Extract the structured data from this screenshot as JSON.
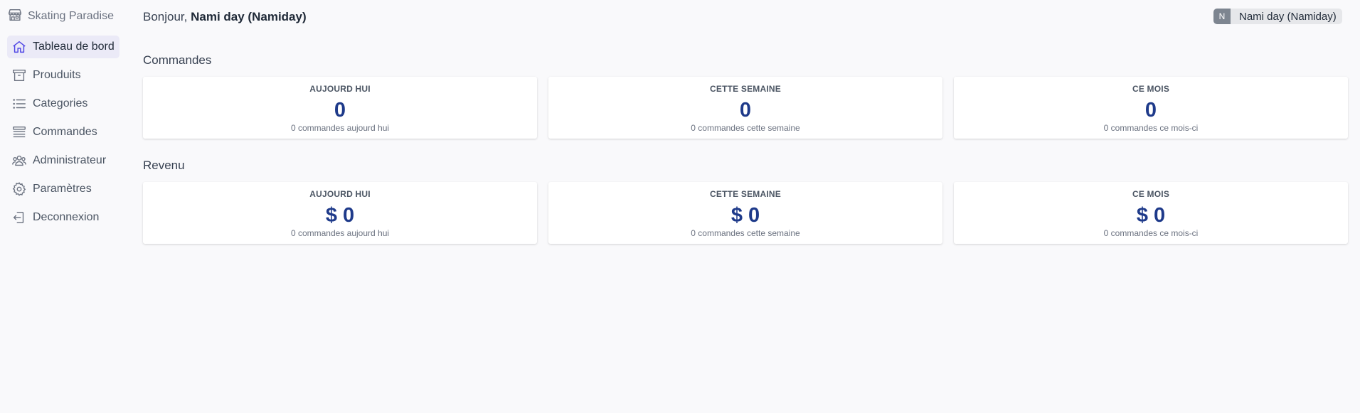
{
  "brand": {
    "name": "Skating Paradise",
    "icon": "store-icon"
  },
  "sidebar": {
    "items": [
      {
        "label": "Tableau de bord",
        "icon": "home-icon",
        "active": true
      },
      {
        "label": "Prouduits",
        "icon": "archive-box-icon"
      },
      {
        "label": "Categories",
        "icon": "list-icon"
      },
      {
        "label": "Commandes",
        "icon": "stack-lines-icon"
      },
      {
        "label": "Administrateur",
        "icon": "users-icon"
      },
      {
        "label": "Paramètres",
        "icon": "gear-icon"
      },
      {
        "label": "Deconnexion",
        "icon": "logout-icon"
      }
    ]
  },
  "header": {
    "greeting": "Bonjour,",
    "user_display": "Nami day (Namiday)",
    "avatar_initial": "N",
    "user_chip_label": "Nami day (Namiday)"
  },
  "commandes": {
    "title": "Commandes",
    "cards": [
      {
        "label": "AUJOURD HUI",
        "value": "0",
        "sub": "0 commandes aujourd hui"
      },
      {
        "label": "CETTE SEMAINE",
        "value": "0",
        "sub": "0 commandes cette semaine"
      },
      {
        "label": "CE MOIS",
        "value": "0",
        "sub": "0 commandes ce mois-ci"
      }
    ]
  },
  "revenu": {
    "title": "Revenu",
    "cards": [
      {
        "label": "AUJOURD HUI",
        "value": "$ 0",
        "sub": "0 commandes aujourd hui"
      },
      {
        "label": "CETTE SEMAINE",
        "value": "$ 0",
        "sub": "0 commandes cette semaine"
      },
      {
        "label": "CE MOIS",
        "value": "$ 0",
        "sub": "0 commandes ce mois-ci"
      }
    ]
  },
  "colors": {
    "accent": "#1e3a8a",
    "active_bg": "#ebeaf7",
    "icon_active": "#4f46e5"
  }
}
